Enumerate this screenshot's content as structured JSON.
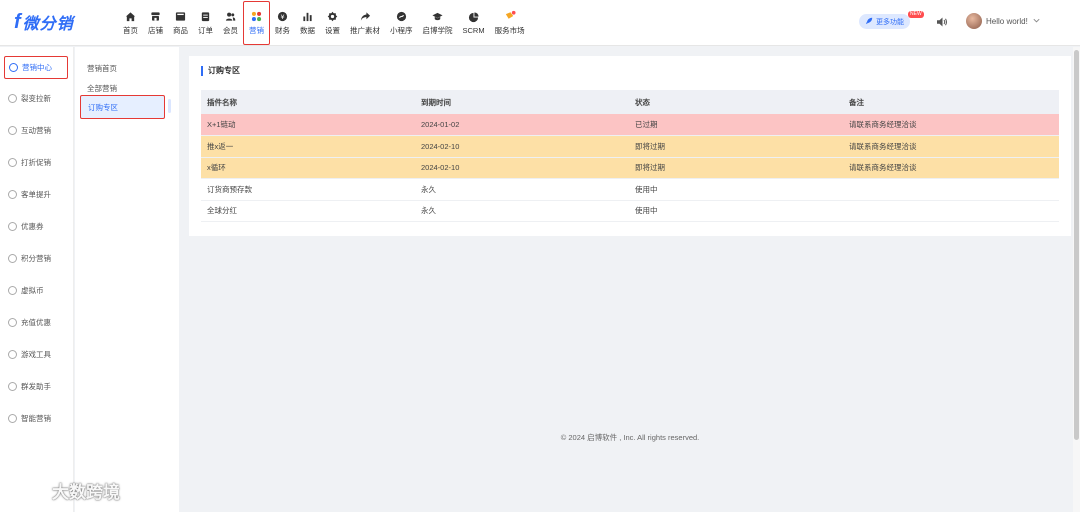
{
  "app": {
    "logo_text": "微分销",
    "logo_mark": "f"
  },
  "nav": [
    {
      "label": "首页",
      "icon": "home-icon"
    },
    {
      "label": "店铺",
      "icon": "shop-icon"
    },
    {
      "label": "商品",
      "icon": "goods-icon"
    },
    {
      "label": "订单",
      "icon": "order-icon"
    },
    {
      "label": "会员",
      "icon": "member-icon"
    },
    {
      "label": "营销",
      "icon": "marketing-icon",
      "active": true
    },
    {
      "label": "财务",
      "icon": "finance-icon"
    },
    {
      "label": "数据",
      "icon": "data-icon"
    },
    {
      "label": "设置",
      "icon": "settings-icon"
    },
    {
      "label": "推广素材",
      "icon": "share-icon"
    },
    {
      "label": "小程序",
      "icon": "miniprogram-icon"
    },
    {
      "label": "启博学院",
      "icon": "academy-icon"
    },
    {
      "label": "SCRM",
      "icon": "scrm-icon"
    },
    {
      "label": "服务市场",
      "icon": "market-icon"
    }
  ],
  "header": {
    "more_label": "更多功能",
    "new_badge": "NEW",
    "user_name": "Hello world!"
  },
  "sidebar": {
    "items": [
      {
        "label": "营销中心",
        "active": true
      },
      {
        "label": "裂变拉新"
      },
      {
        "label": "互动营销"
      },
      {
        "label": "打折促销"
      },
      {
        "label": "客单提升"
      },
      {
        "label": "优惠券"
      },
      {
        "label": "积分营销"
      },
      {
        "label": "虚拟币"
      },
      {
        "label": "充值优惠"
      },
      {
        "label": "游戏工具"
      },
      {
        "label": "群发助手"
      },
      {
        "label": "智能营销"
      }
    ]
  },
  "subnav": {
    "items": [
      {
        "label": "营销首页"
      },
      {
        "label": "全部营销"
      },
      {
        "label": "订购专区",
        "active": true
      }
    ]
  },
  "main": {
    "title": "订购专区",
    "columns": [
      "插件名称",
      "到期时间",
      "状态",
      "备注"
    ],
    "rows": [
      {
        "name": "X+1链动",
        "expire": "2024-01-02",
        "status": "已过期",
        "note": "请联系商务经理洽谈",
        "kind": "expired"
      },
      {
        "name": "推x返一",
        "expire": "2024-02-10",
        "status": "即将过期",
        "note": "请联系商务经理洽谈",
        "kind": "expiring"
      },
      {
        "name": "x循环",
        "expire": "2024-02-10",
        "status": "即将过期",
        "note": "请联系商务经理洽谈",
        "kind": "expiring"
      },
      {
        "name": "订货商预存款",
        "expire": "永久",
        "status": "使用中",
        "note": "",
        "kind": "normal"
      },
      {
        "name": "全球分红",
        "expire": "永久",
        "status": "使用中",
        "note": "",
        "kind": "normal"
      }
    ]
  },
  "footer": {
    "text": "© 2024 启博软件 , Inc. All rights reserved."
  },
  "watermark": {
    "text": "大数跨境"
  },
  "colors": {
    "accent": "#2f6df6",
    "expired": "#fcc4c4",
    "expiring": "#fde0a6",
    "highlight": "#e53935"
  }
}
